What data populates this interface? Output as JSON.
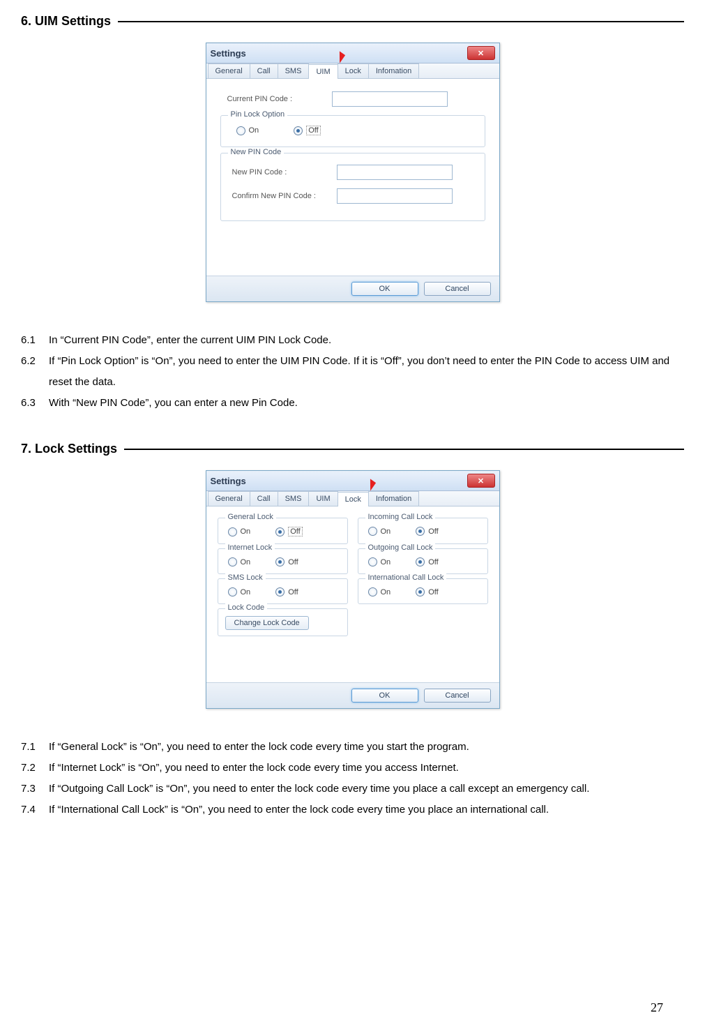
{
  "section6": {
    "heading": "6. UIM Settings"
  },
  "section7": {
    "heading": "7. Lock Settings"
  },
  "uimDialog": {
    "title": "Settings",
    "tabs": [
      "General",
      "Call",
      "SMS",
      "UIM",
      "Lock",
      "Infomation"
    ],
    "activeTab": "UIM",
    "currentPinLabel": "Current PIN Code        :",
    "pinLockGroup": "Pin Lock Option",
    "on": "On",
    "off": "Off",
    "newPinGroup": "New PIN Code",
    "newPinLabel": "New PIN Code           :",
    "confirmPinLabel": "Confirm New PIN Code  :",
    "ok": "OK",
    "cancel": "Cancel"
  },
  "lockDialog": {
    "title": "Settings",
    "tabs": [
      "General",
      "Call",
      "SMS",
      "UIM",
      "Lock",
      "Infomation"
    ],
    "activeTab": "Lock",
    "groups": {
      "general": "General Lock",
      "incoming": "Incoming Call Lock",
      "internet": "Internet Lock",
      "outgoing": "Outgoing Call Lock",
      "sms": "SMS Lock",
      "intl": "International Call Lock",
      "code": "Lock Code"
    },
    "on": "On",
    "off": "Off",
    "changeBtn": "Change Lock Code",
    "ok": "OK",
    "cancel": "Cancel"
  },
  "list6": [
    {
      "num": "6.1",
      "text": "In “Current PIN Code”, enter the current UIM PIN Lock Code."
    },
    {
      "num": "6.2",
      "text": "If “Pin Lock Option” is “On”, you need to enter the UIM PIN Code. If it is “Off”, you don’t need to enter the PIN Code to access UIM and reset the data."
    },
    {
      "num": "6.3",
      "text": "With “New PIN Code”, you can enter a new Pin Code."
    }
  ],
  "list7": [
    {
      "num": "7.1",
      "text": "If “General Lock” is “On”, you need to enter the lock code every time you start the program."
    },
    {
      "num": "7.2",
      "text": "If “Internet Lock” is “On”, you need to enter the lock code every time you access Internet."
    },
    {
      "num": "7.3",
      "text": "If “Outgoing Call Lock” is “On”, you need to enter the lock code every time you place a call except an emergency call."
    },
    {
      "num": "7.4",
      "text": "If “International Call Lock” is “On”, you need to enter the lock code every time you place an international call."
    }
  ],
  "pageNumber": "27"
}
